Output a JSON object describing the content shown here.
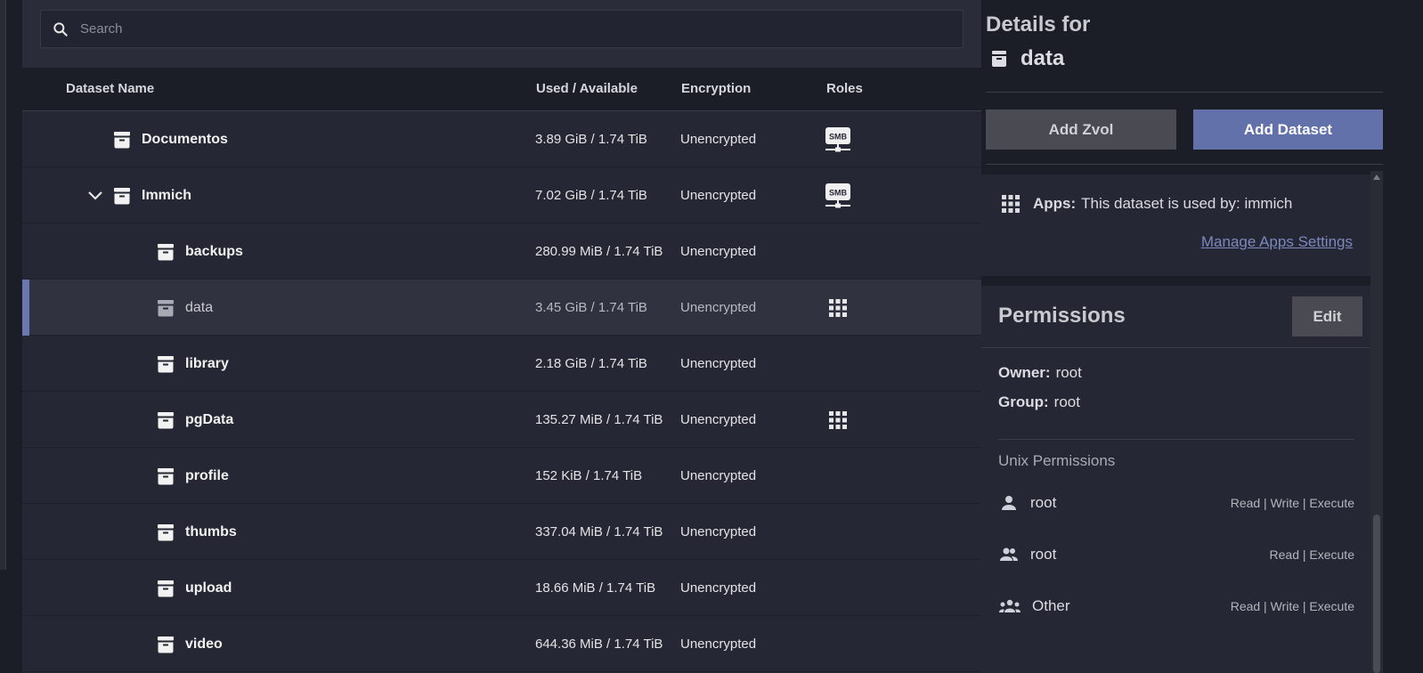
{
  "search": {
    "placeholder": "Search"
  },
  "table": {
    "headers": {
      "name": "Dataset Name",
      "used": "Used / Available",
      "encryption": "Encryption",
      "roles": "Roles"
    },
    "rows": [
      {
        "name": "Documentos",
        "used": "3.89 GiB / 1.74 TiB",
        "encryption": "Unencrypted",
        "role": "smb-icon",
        "depth": 1,
        "expandable": false,
        "selected": false
      },
      {
        "name": "Immich",
        "used": "7.02 GiB / 1.74 TiB",
        "encryption": "Unencrypted",
        "role": "smb-icon",
        "depth": 1,
        "expandable": true,
        "selected": false
      },
      {
        "name": "backups",
        "used": "280.99 MiB / 1.74 TiB",
        "encryption": "Unencrypted",
        "role": "",
        "depth": 2,
        "expandable": false,
        "selected": false
      },
      {
        "name": "data",
        "used": "3.45 GiB / 1.74 TiB",
        "encryption": "Unencrypted",
        "role": "apps-icon",
        "depth": 2,
        "expandable": false,
        "selected": true
      },
      {
        "name": "library",
        "used": "2.18 GiB / 1.74 TiB",
        "encryption": "Unencrypted",
        "role": "",
        "depth": 2,
        "expandable": false,
        "selected": false
      },
      {
        "name": "pgData",
        "used": "135.27 MiB / 1.74 TiB",
        "encryption": "Unencrypted",
        "role": "apps-icon",
        "depth": 2,
        "expandable": false,
        "selected": false
      },
      {
        "name": "profile",
        "used": "152 KiB / 1.74 TiB",
        "encryption": "Unencrypted",
        "role": "",
        "depth": 2,
        "expandable": false,
        "selected": false
      },
      {
        "name": "thumbs",
        "used": "337.04 MiB / 1.74 TiB",
        "encryption": "Unencrypted",
        "role": "",
        "depth": 2,
        "expandable": false,
        "selected": false
      },
      {
        "name": "upload",
        "used": "18.66 MiB / 1.74 TiB",
        "encryption": "Unencrypted",
        "role": "",
        "depth": 2,
        "expandable": false,
        "selected": false
      },
      {
        "name": "video",
        "used": "644.36 MiB / 1.74 TiB",
        "encryption": "Unencrypted",
        "role": "",
        "depth": 2,
        "expandable": false,
        "selected": false
      }
    ]
  },
  "details": {
    "title": "Details for",
    "dataset_name": "data",
    "add_zvol_label": "Add Zvol",
    "add_dataset_label": "Add Dataset",
    "apps": {
      "label": "Apps:",
      "text": "This dataset is used by: immich",
      "manage_link": "Manage Apps Settings"
    },
    "permissions": {
      "title": "Permissions",
      "edit_label": "Edit",
      "owner_label": "Owner:",
      "owner_value": "root",
      "group_label": "Group:",
      "group_value": "root",
      "unix_title": "Unix Permissions",
      "entries": [
        {
          "icon": "user-icon",
          "who": "root",
          "access": "Read | Write | Execute"
        },
        {
          "icon": "group-icon",
          "who": "root",
          "access": "Read | Execute"
        },
        {
          "icon": "other-icon",
          "who": "Other",
          "access": "Read | Write | Execute"
        }
      ]
    }
  },
  "colors": {
    "accent": "#6371ab",
    "selected_bar": "#6a77b0",
    "link": "#7c88bd"
  }
}
